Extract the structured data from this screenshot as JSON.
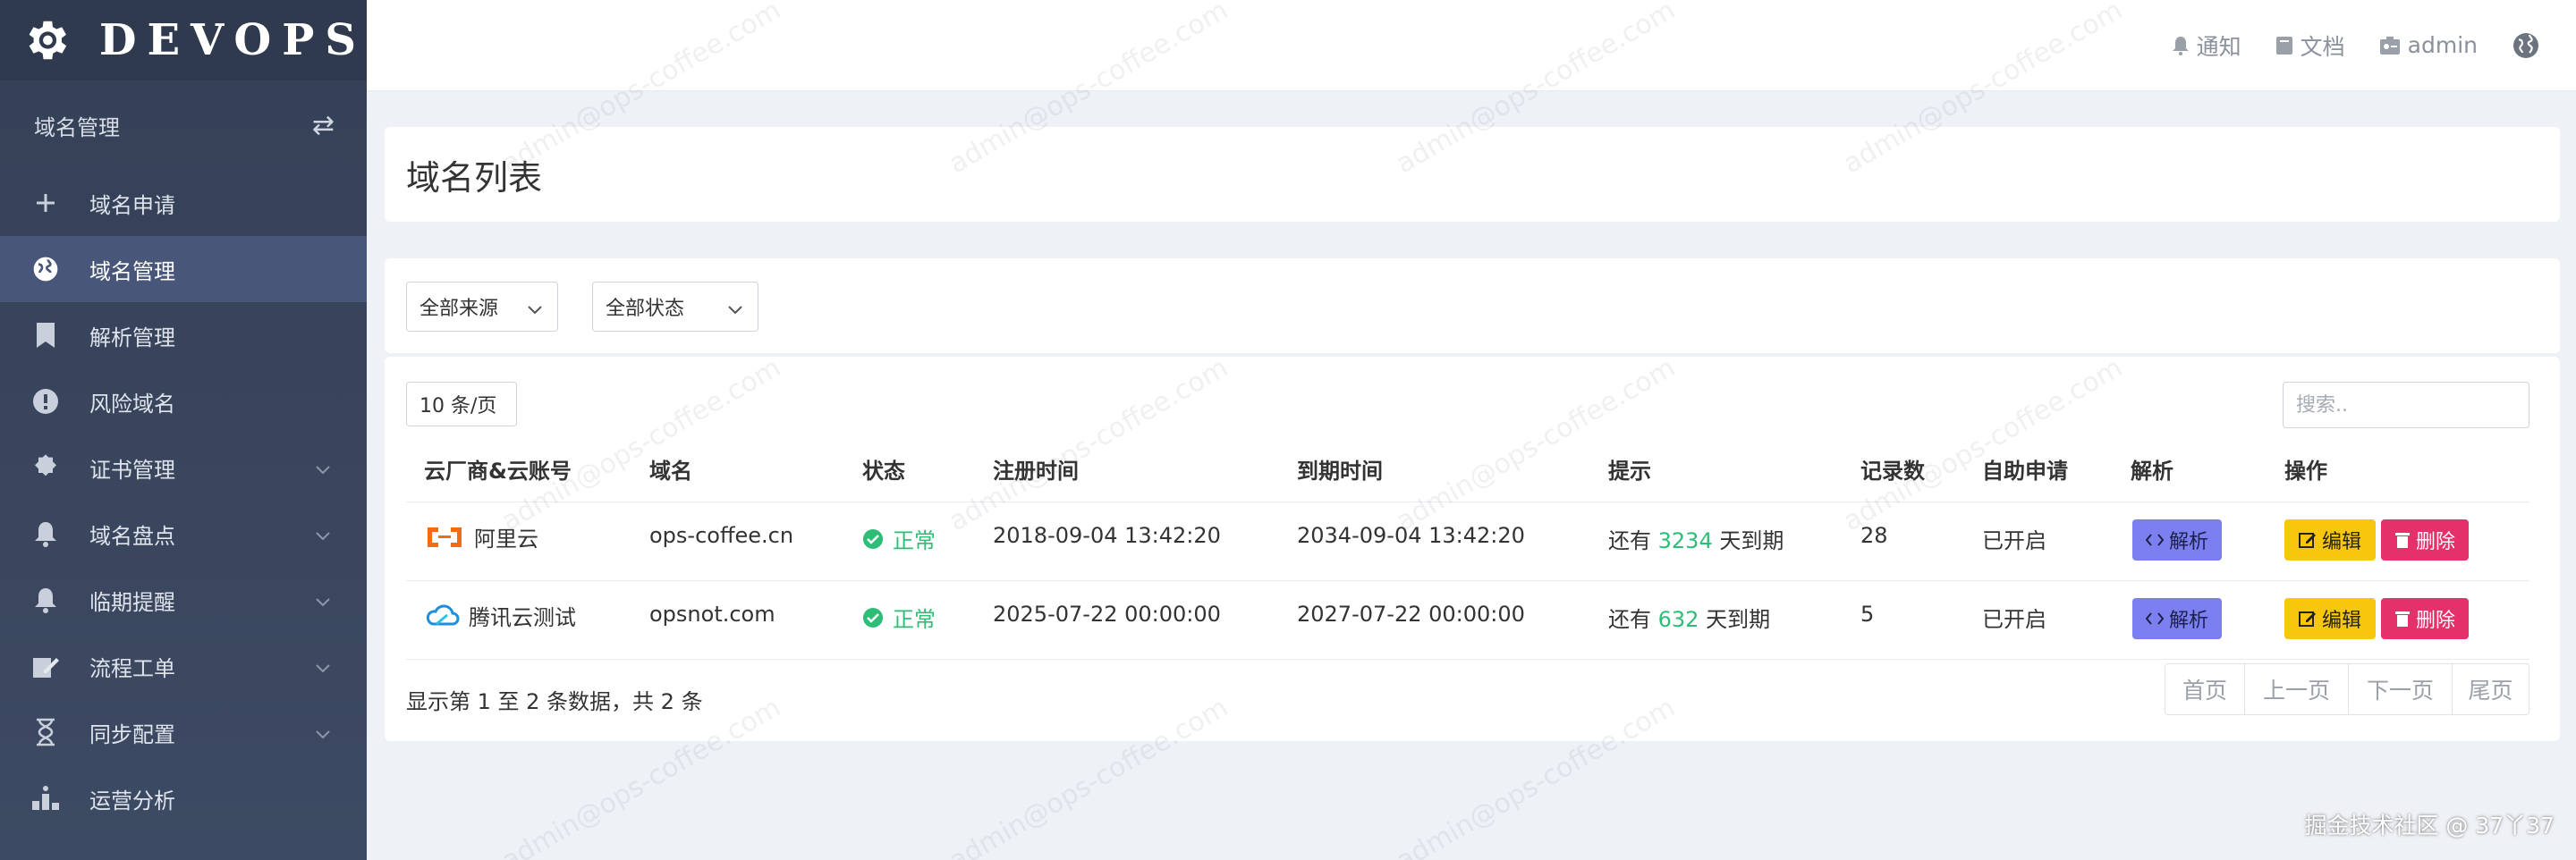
{
  "brand": {
    "title": "DEVOPS"
  },
  "sidebar": {
    "section_title": "域名管理",
    "items": [
      {
        "label": "域名申请",
        "icon": "plus-icon"
      },
      {
        "label": "域名管理",
        "icon": "globe-icon",
        "active": true
      },
      {
        "label": "解析管理",
        "icon": "bookmark-icon"
      },
      {
        "label": "风险域名",
        "icon": "alert-icon"
      },
      {
        "label": "证书管理",
        "icon": "gear-icon"
      },
      {
        "label": "域名盘点",
        "icon": "bell-icon"
      },
      {
        "label": "临期提醒",
        "icon": "bell-icon"
      },
      {
        "label": "流程工单",
        "icon": "edit-icon"
      },
      {
        "label": "同步配置",
        "icon": "hourglass-icon"
      },
      {
        "label": "运营分析",
        "icon": "chart-icon"
      }
    ]
  },
  "topbar": {
    "notify": "通知",
    "docs": "文档",
    "user": "admin"
  },
  "page": {
    "title": "域名列表"
  },
  "filters": {
    "source": "全部来源",
    "status": "全部状态"
  },
  "table": {
    "page_size": "10 条/页",
    "search_placeholder": "搜索..",
    "headers": [
      "云厂商&云账号",
      "域名",
      "状态",
      "注册时间",
      "到期时间",
      "提示",
      "记录数",
      "自助申请",
      "解析",
      "操作"
    ],
    "rows": [
      {
        "provider": "阿里云",
        "domain": "ops-coffee.cn",
        "status": "正常",
        "reg": "2018-09-04 13:42:20",
        "exp": "2034-09-04 13:42:20",
        "hint_pre": "还有",
        "days": "3234",
        "hint_post": "天到期",
        "records": "28",
        "self": "已开启"
      },
      {
        "provider": "腾讯云测试",
        "domain": "opsnot.com",
        "status": "正常",
        "reg": "2025-07-22 00:00:00",
        "exp": "2027-07-22 00:00:00",
        "hint_pre": "还有",
        "days": "632",
        "hint_post": "天到期",
        "records": "5",
        "self": "已开启"
      }
    ],
    "btn_parse": "解析",
    "btn_edit": "编辑",
    "btn_delete": "删除",
    "summary": "显示第 1 至 2 条数据，共 2 条",
    "pager": [
      "首页",
      "上一页",
      "下一页",
      "尾页"
    ]
  },
  "watermark": "admin@ops-coffee.com",
  "credit": "掘金技术社区 @ 37丫37",
  "colors": {
    "sidebar": "#344056",
    "accent_green": "#2dbd76",
    "parse": "#7b7ff0",
    "edit": "#f8c60d",
    "delete": "#e5316b"
  }
}
